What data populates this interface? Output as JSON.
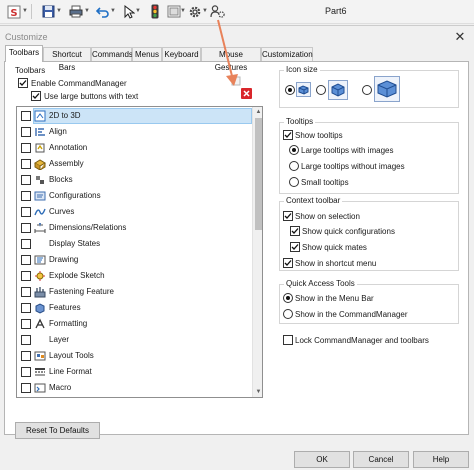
{
  "app_toolbar": {
    "document_title": "Part6",
    "icons": [
      "solidworks-s-icon",
      "new-document-icon",
      "open-icon",
      "save-icon",
      "print-icon",
      "undo-icon",
      "select-icon",
      "traffic-light-icon",
      "rebuild-icon",
      "options-gear-icon",
      "customize-icon"
    ]
  },
  "dialog": {
    "title": "Customize",
    "close_glyph": "✕",
    "tabs": [
      {
        "label": "Toolbars",
        "active": true
      },
      {
        "label": "Shortcut Bars"
      },
      {
        "label": "Commands"
      },
      {
        "label": "Menus"
      },
      {
        "label": "Keyboard"
      },
      {
        "label": "Mouse Gestures"
      },
      {
        "label": "Customization"
      }
    ],
    "toolbars": {
      "section_label": "Toolbars",
      "enable_cm_label": "Enable CommandManager",
      "enable_cm_checked": true,
      "large_buttons_label": "Use large buttons with text",
      "large_buttons_checked": true,
      "items": [
        {
          "label": "2D to 3D",
          "checked": false,
          "selected": true,
          "icon": "2d-to-3d-icon"
        },
        {
          "label": "Align",
          "checked": false,
          "icon": "align-icon"
        },
        {
          "label": "Annotation",
          "checked": false,
          "icon": "annotation-icon"
        },
        {
          "label": "Assembly",
          "checked": false,
          "icon": "assembly-icon"
        },
        {
          "label": "Blocks",
          "checked": false,
          "icon": "blocks-icon"
        },
        {
          "label": "Configurations",
          "checked": false,
          "icon": "configurations-icon"
        },
        {
          "label": "Curves",
          "checked": false,
          "icon": "curves-icon"
        },
        {
          "label": "Dimensions/Relations",
          "checked": false,
          "icon": "dimensions-icon"
        },
        {
          "label": "Display States",
          "checked": false,
          "icon": ""
        },
        {
          "label": "Drawing",
          "checked": false,
          "icon": "drawing-icon"
        },
        {
          "label": "Explode Sketch",
          "checked": false,
          "icon": "explode-sketch-icon"
        },
        {
          "label": "Fastening Feature",
          "checked": false,
          "icon": "fastening-feature-icon"
        },
        {
          "label": "Features",
          "checked": false,
          "icon": "features-icon"
        },
        {
          "label": "Formatting",
          "checked": false,
          "icon": "formatting-icon"
        },
        {
          "label": "Layer",
          "checked": false,
          "icon": ""
        },
        {
          "label": "Layout Tools",
          "checked": false,
          "icon": "layout-tools-icon"
        },
        {
          "label": "Line Format",
          "checked": false,
          "icon": "line-format-icon"
        },
        {
          "label": "Macro",
          "checked": false,
          "icon": "macro-icon"
        }
      ],
      "reset_button": "Reset To Defaults"
    },
    "icon_size": {
      "label": "Icon size",
      "options": [
        {
          "size": "small",
          "selected": true
        },
        {
          "size": "medium",
          "selected": false
        },
        {
          "size": "large",
          "selected": false
        }
      ]
    },
    "tooltips": {
      "label": "Tooltips",
      "show_tooltips_label": "Show tooltips",
      "show_tooltips_checked": true,
      "options": [
        {
          "label": "Large tooltips with images",
          "selected": true
        },
        {
          "label": "Large tooltips without images",
          "selected": false
        },
        {
          "label": "Small tooltips",
          "selected": false
        }
      ]
    },
    "context_toolbar": {
      "label": "Context toolbar",
      "show_on_selection_label": "Show on selection",
      "show_on_selection_checked": true,
      "show_quick_configs_label": "Show quick configurations",
      "show_quick_configs_checked": true,
      "show_quick_mates_label": "Show quick mates",
      "show_quick_mates_checked": true,
      "show_in_shortcut_label": "Show in shortcut menu",
      "show_in_shortcut_checked": true
    },
    "quick_access": {
      "label": "Quick Access Tools",
      "options": [
        {
          "label": "Show in the Menu Bar",
          "selected": true
        },
        {
          "label": "Show in the CommandManager",
          "selected": false
        }
      ]
    },
    "lock_label": "Lock CommandManager and toolbars",
    "lock_checked": false,
    "buttons": {
      "ok": "OK",
      "cancel": "Cancel",
      "help": "Help"
    }
  },
  "colors": {
    "annotation_arrow": "#e8825a",
    "selection_bg": "#cce4f7",
    "accent_blue": "#1f6fc5",
    "remove_red": "#d9262b"
  }
}
